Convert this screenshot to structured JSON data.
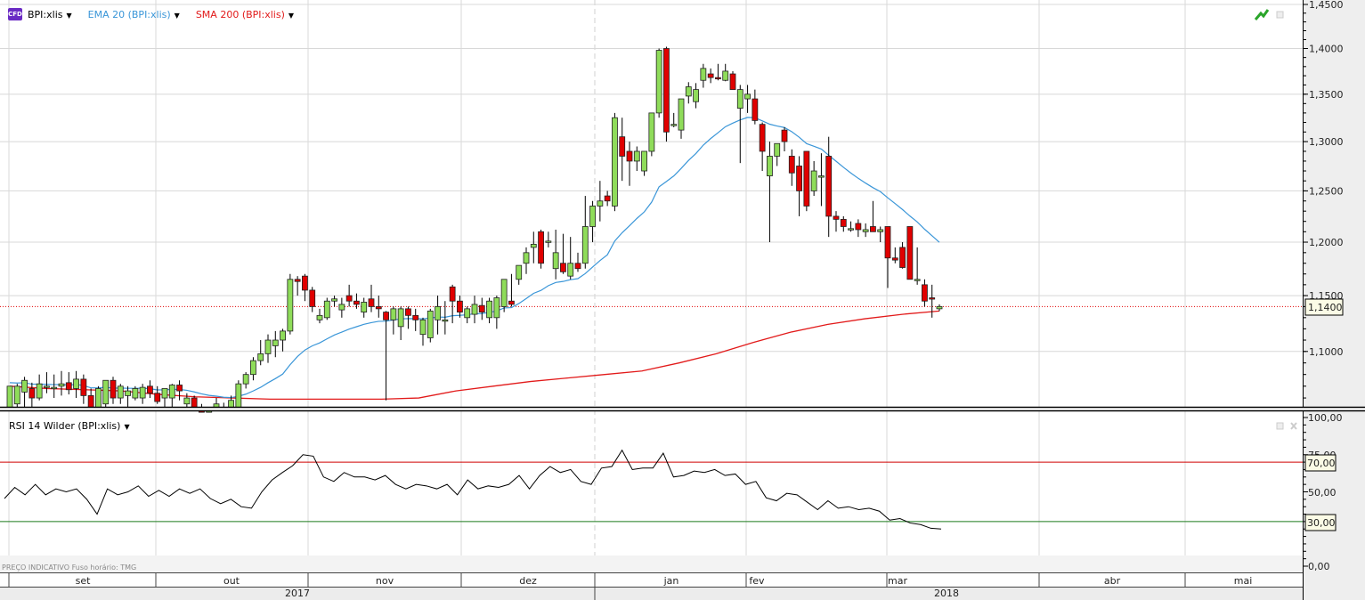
{
  "legend": {
    "symbol": "BPI:xlis",
    "ema": "EMA 20 (BPI:xlis)",
    "sma": "SMA 200 (BPI:xlis)",
    "rsi": "RSI 14 Wilder (BPI:xlis)",
    "cfd_badge": "CFD"
  },
  "footnote": "PREÇO INDICATIVO   Fuso horário: TMG",
  "colors": {
    "up": "#8fdc5a",
    "down": "#e00000",
    "ema": "#3a96d8",
    "sma": "#e21a1a",
    "rsi": "#000000",
    "rsi_high": "#d00000",
    "rsi_low": "#1a7a1a"
  },
  "chart_data": {
    "type": "candlestick",
    "price_axis": {
      "ticks": [
        "1,4500",
        "1,4000",
        "1,3500",
        "1,3000",
        "1,2500",
        "1,2000",
        "1,1500",
        "1,1000"
      ],
      "values": [
        1.45,
        1.4,
        1.35,
        1.3,
        1.25,
        1.2,
        1.15,
        1.1
      ],
      "range": [
        1.045,
        1.45
      ],
      "scale": "log"
    },
    "last_price": {
      "value": 1.14,
      "label": "1,1400"
    },
    "months": [
      "set",
      "out",
      "nov",
      "dez",
      "jan",
      "fev",
      "mar",
      "abr",
      "mai"
    ],
    "years": [
      "2017",
      "2018"
    ],
    "ohlc": [
      [
        1.05,
        1.07,
        1.045,
        1.07
      ],
      [
        1.055,
        1.072,
        1.048,
        1.07
      ],
      [
        1.065,
        1.078,
        1.05,
        1.075
      ],
      [
        1.068,
        1.073,
        1.052,
        1.06
      ],
      [
        1.06,
        1.08,
        1.058,
        1.072
      ],
      [
        1.07,
        1.082,
        1.064,
        1.07
      ],
      [
        1.068,
        1.08,
        1.06,
        1.069
      ],
      [
        1.07,
        1.083,
        1.062,
        1.072
      ],
      [
        1.073,
        1.082,
        1.063,
        1.067
      ],
      [
        1.068,
        1.083,
        1.06,
        1.076
      ],
      [
        1.076,
        1.08,
        1.055,
        1.062
      ],
      [
        1.062,
        1.068,
        1.04,
        1.05
      ],
      [
        1.05,
        1.07,
        1.045,
        1.068
      ],
      [
        1.055,
        1.075,
        1.05,
        1.075
      ],
      [
        1.075,
        1.078,
        1.055,
        1.06
      ],
      [
        1.06,
        1.072,
        1.055,
        1.07
      ],
      [
        1.062,
        1.07,
        1.05,
        1.066
      ],
      [
        1.06,
        1.07,
        1.058,
        1.068
      ],
      [
        1.06,
        1.072,
        1.055,
        1.069
      ],
      [
        1.07,
        1.075,
        1.06,
        1.064
      ],
      [
        1.064,
        1.07,
        1.055,
        1.057
      ],
      [
        1.06,
        1.068,
        1.052,
        1.068
      ],
      [
        1.06,
        1.072,
        1.05,
        1.071
      ],
      [
        1.071,
        1.075,
        1.058,
        1.066
      ],
      [
        1.055,
        1.064,
        1.05,
        1.06
      ],
      [
        1.06,
        1.062,
        1.05,
        1.052
      ],
      [
        1.052,
        1.055,
        1.045,
        1.048
      ],
      [
        1.048,
        1.052,
        1.04,
        1.05
      ],
      [
        1.05,
        1.06,
        1.045,
        1.055
      ],
      [
        1.05,
        1.056,
        1.045,
        1.052
      ],
      [
        1.052,
        1.062,
        1.048,
        1.058
      ],
      [
        1.05,
        1.075,
        1.048,
        1.072
      ],
      [
        1.072,
        1.082,
        1.068,
        1.08
      ],
      [
        1.08,
        1.095,
        1.075,
        1.092
      ],
      [
        1.092,
        1.11,
        1.088,
        1.098
      ],
      [
        1.098,
        1.115,
        1.09,
        1.11
      ],
      [
        1.105,
        1.118,
        1.095,
        1.11
      ],
      [
        1.11,
        1.12,
        1.1,
        1.118
      ],
      [
        1.118,
        1.17,
        1.115,
        1.165
      ],
      [
        1.165,
        1.168,
        1.15,
        1.163
      ],
      [
        1.168,
        1.17,
        1.145,
        1.155
      ],
      [
        1.155,
        1.158,
        1.135,
        1.14
      ],
      [
        1.128,
        1.138,
        1.125,
        1.132
      ],
      [
        1.13,
        1.148,
        1.128,
        1.145
      ],
      [
        1.145,
        1.15,
        1.14,
        1.147
      ],
      [
        1.137,
        1.148,
        1.13,
        1.142
      ],
      [
        1.15,
        1.16,
        1.14,
        1.145
      ],
      [
        1.145,
        1.152,
        1.138,
        1.142
      ],
      [
        1.135,
        1.148,
        1.13,
        1.144
      ],
      [
        1.147,
        1.16,
        1.135,
        1.14
      ],
      [
        1.14,
        1.15,
        1.13,
        1.138
      ],
      [
        1.135,
        1.136,
        1.058,
        1.128
      ],
      [
        1.128,
        1.14,
        1.115,
        1.138
      ],
      [
        1.122,
        1.14,
        1.11,
        1.138
      ],
      [
        1.138,
        1.14,
        1.12,
        1.132
      ],
      [
        1.132,
        1.138,
        1.118,
        1.128
      ],
      [
        1.115,
        1.13,
        1.105,
        1.128
      ],
      [
        1.112,
        1.138,
        1.108,
        1.136
      ],
      [
        1.128,
        1.15,
        1.115,
        1.14
      ],
      [
        1.128,
        1.145,
        1.115,
        1.128
      ],
      [
        1.158,
        1.16,
        1.125,
        1.145
      ],
      [
        1.145,
        1.15,
        1.13,
        1.135
      ],
      [
        1.13,
        1.14,
        1.125,
        1.138
      ],
      [
        1.133,
        1.15,
        1.125,
        1.142
      ],
      [
        1.141,
        1.148,
        1.128,
        1.135
      ],
      [
        1.13,
        1.148,
        1.125,
        1.145
      ],
      [
        1.13,
        1.15,
        1.12,
        1.148
      ],
      [
        1.14,
        1.165,
        1.135,
        1.165
      ],
      [
        1.145,
        1.17,
        1.14,
        1.142
      ],
      [
        1.165,
        1.175,
        1.16,
        1.178
      ],
      [
        1.18,
        1.195,
        1.17,
        1.19
      ],
      [
        1.195,
        1.21,
        1.18,
        1.198
      ],
      [
        1.21,
        1.212,
        1.175,
        1.18
      ],
      [
        1.2,
        1.21,
        1.195,
        1.201
      ],
      [
        1.175,
        1.212,
        1.165,
        1.19
      ],
      [
        1.18,
        1.208,
        1.17,
        1.172
      ],
      [
        1.168,
        1.205,
        1.165,
        1.18
      ],
      [
        1.18,
        1.19,
        1.172,
        1.175
      ],
      [
        1.18,
        1.245,
        1.175,
        1.215
      ],
      [
        1.215,
        1.24,
        1.2,
        1.235
      ],
      [
        1.235,
        1.26,
        1.22,
        1.24
      ],
      [
        1.245,
        1.25,
        1.235,
        1.24
      ],
      [
        1.235,
        1.33,
        1.23,
        1.325
      ],
      [
        1.305,
        1.325,
        1.26,
        1.285
      ],
      [
        1.29,
        1.3,
        1.255,
        1.28
      ],
      [
        1.28,
        1.295,
        1.27,
        1.29
      ],
      [
        1.27,
        1.29,
        1.265,
        1.29
      ],
      [
        1.29,
        1.33,
        1.285,
        1.33
      ],
      [
        1.33,
        1.4,
        1.325,
        1.398
      ],
      [
        1.4,
        1.402,
        1.3,
        1.31
      ],
      [
        1.318,
        1.33,
        1.315,
        1.318
      ],
      [
        1.312,
        1.345,
        1.303,
        1.345
      ],
      [
        1.348,
        1.363,
        1.34,
        1.358
      ],
      [
        1.342,
        1.362,
        1.335,
        1.355
      ],
      [
        1.365,
        1.383,
        1.357,
        1.378
      ],
      [
        1.372,
        1.378,
        1.362,
        1.368
      ],
      [
        1.368,
        1.383,
        1.365,
        1.367
      ],
      [
        1.365,
        1.383,
        1.364,
        1.375
      ],
      [
        1.372,
        1.375,
        1.355,
        1.355
      ],
      [
        1.335,
        1.36,
        1.278,
        1.355
      ],
      [
        1.345,
        1.36,
        1.33,
        1.35
      ],
      [
        1.345,
        1.355,
        1.318,
        1.322
      ],
      [
        1.318,
        1.32,
        1.27,
        1.29
      ],
      [
        1.265,
        1.3,
        1.2,
        1.285
      ],
      [
        1.285,
        1.298,
        1.275,
        1.298
      ],
      [
        1.312,
        1.315,
        1.29,
        1.3
      ],
      [
        1.285,
        1.292,
        1.255,
        1.268
      ],
      [
        1.275,
        1.285,
        1.225,
        1.25
      ],
      [
        1.29,
        1.29,
        1.23,
        1.235
      ],
      [
        1.25,
        1.28,
        1.245,
        1.27
      ],
      [
        1.265,
        1.288,
        1.235,
        1.265
      ],
      [
        1.285,
        1.305,
        1.205,
        1.225
      ],
      [
        1.225,
        1.23,
        1.21,
        1.222
      ],
      [
        1.222,
        1.225,
        1.21,
        1.215
      ],
      [
        1.212,
        1.22,
        1.21,
        1.213
      ],
      [
        1.218,
        1.222,
        1.205,
        1.212
      ],
      [
        1.21,
        1.218,
        1.205,
        1.212
      ],
      [
        1.215,
        1.24,
        1.21,
        1.21
      ],
      [
        1.21,
        1.215,
        1.2,
        1.212
      ],
      [
        1.215,
        1.215,
        1.157,
        1.185
      ],
      [
        1.185,
        1.195,
        1.18,
        1.183
      ],
      [
        1.195,
        1.2,
        1.175,
        1.176
      ],
      [
        1.215,
        1.215,
        1.165,
        1.165
      ],
      [
        1.165,
        1.195,
        1.16,
        1.165
      ],
      [
        1.16,
        1.165,
        1.14,
        1.145
      ],
      [
        1.148,
        1.16,
        1.13,
        1.147
      ],
      [
        1.138,
        1.142,
        1.136,
        1.14
      ]
    ],
    "sma200": [
      1.07,
      1.068,
      1.067,
      1.066,
      1.063,
      1.061,
      1.06,
      1.059,
      1.059,
      1.059,
      1.059,
      1.06,
      1.066,
      1.07,
      1.074,
      1.077,
      1.08,
      1.083,
      1.09,
      1.098,
      1.108,
      1.117,
      1.124,
      1.129,
      1.133,
      1.136
    ],
    "rsi": {
      "axis_ticks": [
        "100,00",
        "75,00",
        "50,00",
        "0,00"
      ],
      "axis_values": [
        100,
        75,
        50,
        0
      ],
      "levels": [
        {
          "value": 70,
          "label": "70,00"
        },
        {
          "value": 30,
          "label": "30,00"
        }
      ],
      "values": [
        45.5,
        53,
        48,
        55,
        48,
        52,
        50,
        52,
        45,
        35,
        52,
        48,
        50,
        54,
        47,
        51,
        47,
        52,
        49,
        52,
        45.5,
        42,
        45,
        40,
        39,
        50,
        58,
        63,
        67.6,
        75,
        74,
        60,
        57,
        63,
        60,
        60,
        58,
        61,
        55,
        52,
        55,
        54,
        52,
        55,
        48,
        58,
        52,
        54,
        53,
        55,
        61,
        52,
        61,
        67,
        63,
        65,
        57,
        55,
        66,
        67,
        78,
        65,
        66,
        66,
        76,
        60,
        61,
        64,
        63,
        65,
        61,
        62,
        55,
        57,
        46,
        44,
        49,
        48,
        43,
        38,
        44,
        39,
        40,
        38,
        39,
        37,
        31,
        32,
        29,
        28,
        25.5,
        25
      ]
    }
  }
}
